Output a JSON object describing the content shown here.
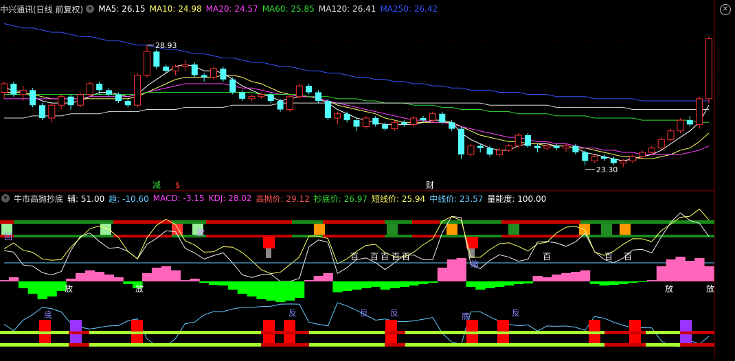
{
  "header": {
    "title": "中兴通讯(日线 前复权)",
    "indicators": [
      {
        "label": "MA5: 26.15",
        "color": "#ffffff"
      },
      {
        "label": "MA10: 24.98",
        "color": "#ffff66"
      },
      {
        "label": "MA20: 24.57",
        "color": "#ff44ff"
      },
      {
        "label": "MA60: 25.85",
        "color": "#33dd33"
      },
      {
        "label": "MA120: 26.41",
        "color": "#dddddd"
      },
      {
        "label": "MA250: 26.42",
        "color": "#3355ff"
      }
    ]
  },
  "subheader": {
    "title": "牛市高抛抄底",
    "indicators": [
      {
        "label": "辅: 51.00",
        "color": "#ffffff"
      },
      {
        "label": "趋: -10.60",
        "color": "#66ccff"
      },
      {
        "label": "MACD: -3.15",
        "color": "#ff44ff"
      },
      {
        "label": "KDJ: 28.02",
        "color": "#ff44ff"
      },
      {
        "label": "高抛价: 29.12",
        "color": "#ff5555"
      },
      {
        "label": "抄底价: 26.97",
        "color": "#33dd33"
      },
      {
        "label": "短线价: 25.94",
        "color": "#ffff66"
      },
      {
        "label": "中线价: 23.57",
        "color": "#66ccff"
      },
      {
        "label": "量能度: 100.00",
        "color": "#ffffff"
      }
    ]
  },
  "chart_data": {
    "type": "candlestick",
    "price_range": [
      22.3,
      30.3
    ],
    "annotations": {
      "high": "28.93",
      "low": "23.30"
    },
    "top_markers": [
      {
        "text": "减",
        "color": "#33dd33"
      },
      {
        "text": "$",
        "color": "#ff3333"
      },
      {
        "text": "财",
        "color": "#ffffff"
      }
    ],
    "candles": [
      [
        26.7,
        27.2,
        26.4,
        27.1
      ],
      [
        27.1,
        27.2,
        26.5,
        26.6
      ],
      [
        26.6,
        27.0,
        26.3,
        26.8
      ],
      [
        26.8,
        26.9,
        26.0,
        26.1
      ],
      [
        26.1,
        26.2,
        25.4,
        25.5
      ],
      [
        25.5,
        26.2,
        25.3,
        26.1
      ],
      [
        26.1,
        26.6,
        25.9,
        26.5
      ],
      [
        26.5,
        26.6,
        25.9,
        26.1
      ],
      [
        26.1,
        26.7,
        26.0,
        26.6
      ],
      [
        26.6,
        27.2,
        26.5,
        27.1
      ],
      [
        27.1,
        27.2,
        26.6,
        26.8
      ],
      [
        26.8,
        26.9,
        26.5,
        26.6
      ],
      [
        26.6,
        26.7,
        26.2,
        26.3
      ],
      [
        26.3,
        26.4,
        26.0,
        26.1
      ],
      [
        26.1,
        27.6,
        26.0,
        27.5
      ],
      [
        27.5,
        28.9,
        27.4,
        28.6
      ],
      [
        28.6,
        28.7,
        27.8,
        27.9
      ],
      [
        27.9,
        28.0,
        27.6,
        27.7
      ],
      [
        27.7,
        28.0,
        27.5,
        27.9
      ],
      [
        27.9,
        28.2,
        27.7,
        28.0
      ],
      [
        28.0,
        28.1,
        27.4,
        27.5
      ],
      [
        27.5,
        27.6,
        27.2,
        27.4
      ],
      [
        27.4,
        27.9,
        27.3,
        27.8
      ],
      [
        27.8,
        27.9,
        27.2,
        27.3
      ],
      [
        27.3,
        27.4,
        26.6,
        26.7
      ],
      [
        26.7,
        26.8,
        26.3,
        26.4
      ],
      [
        26.4,
        26.6,
        26.3,
        26.5
      ],
      [
        26.5,
        26.7,
        26.4,
        26.6
      ],
      [
        26.6,
        26.7,
        26.2,
        26.3
      ],
      [
        26.3,
        26.4,
        25.8,
        25.9
      ],
      [
        25.9,
        26.6,
        25.8,
        26.5
      ],
      [
        26.5,
        27.1,
        26.4,
        27.0
      ],
      [
        27.0,
        27.1,
        26.6,
        26.7
      ],
      [
        26.7,
        26.8,
        26.2,
        26.3
      ],
      [
        26.3,
        26.4,
        25.4,
        25.5
      ],
      [
        25.5,
        25.8,
        25.2,
        25.7
      ],
      [
        25.7,
        25.8,
        25.3,
        25.4
      ],
      [
        25.4,
        25.5,
        24.9,
        25.1
      ],
      [
        25.1,
        25.6,
        25.0,
        25.5
      ],
      [
        25.5,
        25.6,
        25.1,
        25.2
      ],
      [
        25.2,
        25.3,
        24.9,
        25.0
      ],
      [
        25.0,
        25.4,
        24.9,
        25.3
      ],
      [
        25.3,
        25.4,
        25.1,
        25.2
      ],
      [
        25.2,
        25.6,
        25.1,
        25.5
      ],
      [
        25.5,
        25.6,
        25.3,
        25.4
      ],
      [
        25.4,
        25.8,
        25.3,
        25.7
      ],
      [
        25.7,
        25.8,
        25.2,
        25.3
      ],
      [
        25.3,
        25.4,
        24.9,
        25.0
      ],
      [
        25.0,
        25.1,
        23.6,
        23.8
      ],
      [
        23.8,
        24.3,
        23.7,
        24.2
      ],
      [
        24.2,
        24.3,
        23.9,
        24.1
      ],
      [
        24.1,
        24.2,
        23.7,
        23.8
      ],
      [
        23.8,
        24.1,
        23.7,
        24.0
      ],
      [
        24.0,
        24.3,
        23.9,
        24.2
      ],
      [
        24.2,
        24.8,
        24.1,
        24.7
      ],
      [
        24.7,
        24.8,
        24.1,
        24.2
      ],
      [
        24.2,
        24.3,
        23.9,
        24.1
      ],
      [
        24.1,
        24.3,
        24.0,
        24.2
      ],
      [
        24.2,
        24.3,
        24.0,
        24.1
      ],
      [
        24.1,
        24.3,
        23.9,
        24.2
      ],
      [
        24.2,
        24.3,
        23.8,
        23.9
      ],
      [
        23.9,
        24.0,
        23.3,
        23.5
      ],
      [
        23.5,
        23.8,
        23.4,
        23.7
      ],
      [
        23.7,
        23.8,
        23.5,
        23.6
      ],
      [
        23.6,
        23.7,
        23.3,
        23.4
      ],
      [
        23.4,
        23.6,
        23.2,
        23.5
      ],
      [
        23.5,
        23.8,
        23.4,
        23.7
      ],
      [
        23.7,
        24.0,
        23.6,
        23.9
      ],
      [
        23.9,
        24.2,
        23.8,
        24.1
      ],
      [
        24.1,
        24.6,
        24.0,
        24.5
      ],
      [
        24.5,
        25.0,
        24.4,
        24.9
      ],
      [
        24.9,
        25.5,
        24.8,
        25.4
      ],
      [
        25.4,
        25.6,
        25.1,
        25.2
      ],
      [
        25.2,
        26.5,
        25.0,
        26.4
      ],
      [
        26.4,
        29.3,
        26.2,
        29.2
      ]
    ],
    "ma_lines": [
      {
        "name": "MA5",
        "color": "#ffffff",
        "values": [
          26.9,
          26.8,
          26.7,
          26.5,
          26.3,
          26.2,
          26.2,
          26.2,
          26.3,
          26.5,
          26.7,
          26.7,
          26.6,
          26.5,
          26.6,
          27.0,
          27.3,
          27.6,
          27.9,
          28.0,
          27.9,
          27.7,
          27.7,
          27.6,
          27.3,
          27.0,
          26.8,
          26.6,
          26.5,
          26.3,
          26.4,
          26.5,
          26.5,
          26.4,
          26.2,
          25.9,
          25.7,
          25.5,
          25.4,
          25.3,
          25.2,
          25.2,
          25.2,
          25.2,
          25.3,
          25.4,
          25.4,
          25.3,
          24.8,
          24.5,
          24.3,
          24.1,
          24.0,
          24.0,
          24.2,
          24.3,
          24.3,
          24.3,
          24.2,
          24.2,
          24.1,
          23.9,
          23.8,
          23.7,
          23.6,
          23.5,
          23.6,
          23.7,
          23.8,
          24.0,
          24.3,
          24.6,
          24.9,
          25.3,
          26.1
        ]
      },
      {
        "name": "MA10",
        "color": "#ffff66",
        "values": [
          26.7,
          26.7,
          26.7,
          26.6,
          26.5,
          26.4,
          26.4,
          26.4,
          26.4,
          26.4,
          26.4,
          26.4,
          26.4,
          26.4,
          26.5,
          26.7,
          26.9,
          27.1,
          27.3,
          27.4,
          27.4,
          27.4,
          27.4,
          27.5,
          27.5,
          27.4,
          27.2,
          27.1,
          26.9,
          26.7,
          26.6,
          26.5,
          26.5,
          26.4,
          26.3,
          26.1,
          26.0,
          25.9,
          25.8,
          25.7,
          25.5,
          25.4,
          25.3,
          25.3,
          25.3,
          25.3,
          25.3,
          25.3,
          25.1,
          24.9,
          24.7,
          24.6,
          24.5,
          24.4,
          24.4,
          24.3,
          24.3,
          24.2,
          24.2,
          24.2,
          24.1,
          24.1,
          24.0,
          23.9,
          23.8,
          23.7,
          23.7,
          23.6,
          23.6,
          23.7,
          23.8,
          24.0,
          24.1,
          24.4,
          24.8
        ]
      },
      {
        "name": "MA20",
        "color": "#ff44ff",
        "values": [
          26.4,
          26.4,
          26.4,
          26.4,
          26.4,
          26.4,
          26.4,
          26.4,
          26.4,
          26.5,
          26.5,
          26.5,
          26.5,
          26.5,
          26.6,
          26.7,
          26.8,
          26.9,
          27.0,
          27.1,
          27.1,
          27.1,
          27.1,
          27.1,
          27.0,
          26.9,
          26.9,
          26.8,
          26.7,
          26.6,
          26.6,
          26.5,
          26.5,
          26.4,
          26.3,
          26.2,
          26.1,
          26.0,
          25.9,
          25.8,
          25.7,
          25.6,
          25.5,
          25.4,
          25.4,
          25.3,
          25.3,
          25.2,
          25.1,
          25.0,
          24.9,
          24.8,
          24.7,
          24.6,
          24.6,
          24.5,
          24.4,
          24.4,
          24.3,
          24.3,
          24.2,
          24.1,
          24.1,
          24.0,
          24.0,
          23.9,
          23.9,
          23.8,
          23.8,
          23.8,
          23.8,
          23.8,
          23.9,
          24.0,
          24.2
        ]
      },
      {
        "name": "MA60",
        "color": "#33dd33",
        "values": [
          26.6,
          26.6,
          26.6,
          26.6,
          26.6,
          26.6,
          26.6,
          26.6,
          26.6,
          26.6,
          26.6,
          26.6,
          26.6,
          26.6,
          26.6,
          26.7,
          26.7,
          26.7,
          26.7,
          26.7,
          26.7,
          26.7,
          26.7,
          26.7,
          26.7,
          26.7,
          26.7,
          26.6,
          26.6,
          26.6,
          26.6,
          26.6,
          26.5,
          26.5,
          26.5,
          26.4,
          26.4,
          26.4,
          26.3,
          26.3,
          26.2,
          26.2,
          26.2,
          26.1,
          26.1,
          26.1,
          26.0,
          26.0,
          25.9,
          25.9,
          25.9,
          25.8,
          25.8,
          25.8,
          25.7,
          25.7,
          25.7,
          25.7,
          25.6,
          25.6,
          25.6,
          25.6,
          25.5,
          25.5,
          25.5,
          25.5,
          25.5,
          25.4,
          25.4,
          25.4,
          25.4,
          25.4,
          25.4,
          25.3,
          25.3
        ]
      },
      {
        "name": "MA120",
        "color": "#dddddd",
        "values": [
          25.5,
          25.5,
          25.5,
          25.6,
          25.6,
          25.6,
          25.6,
          25.7,
          25.7,
          25.7,
          25.7,
          25.8,
          25.8,
          25.8,
          25.8,
          25.9,
          25.9,
          25.9,
          25.9,
          26.0,
          26.0,
          26.0,
          26.0,
          26.0,
          26.1,
          26.1,
          26.1,
          26.1,
          26.1,
          26.2,
          26.2,
          26.2,
          26.2,
          26.2,
          26.2,
          26.2,
          26.2,
          26.2,
          26.2,
          26.2,
          26.2,
          26.2,
          26.2,
          26.2,
          26.2,
          26.2,
          26.2,
          26.2,
          26.2,
          26.2,
          26.2,
          26.1,
          26.1,
          26.1,
          26.1,
          26.1,
          26.1,
          26.1,
          26.0,
          26.0,
          26.0,
          26.0,
          26.0,
          26.0,
          26.0,
          26.0,
          25.9,
          25.9,
          25.9,
          25.9,
          25.9,
          25.9,
          25.9,
          25.9,
          25.9
        ]
      },
      {
        "name": "MA250",
        "color": "#3355ff",
        "values": [
          29.9,
          29.8,
          29.7,
          29.7,
          29.6,
          29.5,
          29.5,
          29.4,
          29.3,
          29.3,
          29.2,
          29.1,
          29.1,
          29.0,
          28.9,
          28.9,
          28.8,
          28.7,
          28.7,
          28.6,
          28.5,
          28.5,
          28.4,
          28.3,
          28.3,
          28.2,
          28.1,
          28.1,
          28.0,
          27.9,
          27.9,
          27.8,
          27.7,
          27.7,
          27.6,
          27.6,
          27.5,
          27.4,
          27.4,
          27.3,
          27.3,
          27.2,
          27.2,
          27.1,
          27.1,
          27.0,
          27.0,
          26.9,
          26.9,
          26.8,
          26.8,
          26.8,
          26.7,
          26.7,
          26.7,
          26.6,
          26.6,
          26.6,
          26.5,
          26.5,
          26.5,
          26.5,
          26.4,
          26.4,
          26.4,
          26.4,
          26.4,
          26.3,
          26.3,
          26.3,
          26.3,
          26.3,
          26.3,
          26.3,
          26.3
        ]
      }
    ],
    "signal_labels": [
      {
        "text": "回",
        "color": "#8888ff"
      },
      {
        "text": "放",
        "color": "#cc99ff"
      },
      {
        "text": "百",
        "color": "#ffffff"
      },
      {
        "text": "百",
        "color": "#ffffff"
      },
      {
        "text": "百",
        "color": "#ffffff"
      },
      {
        "text": "百",
        "color": "#ffffff"
      },
      {
        "text": "百",
        "color": "#ffffff"
      },
      {
        "text": "缩",
        "color": "#8888ff"
      },
      {
        "text": "百",
        "color": "#ffffff"
      },
      {
        "text": "百",
        "color": "#ffffff"
      },
      {
        "text": "百",
        "color": "#ffffff"
      },
      {
        "text": "放",
        "color": "#ffffff"
      },
      {
        "text": "放",
        "color": "#ffffff"
      },
      {
        "text": "放",
        "color": "#ffffff"
      },
      {
        "text": "放",
        "color": "#ffffff"
      },
      {
        "text": "底",
        "color": "#8888ff"
      },
      {
        "text": "反",
        "color": "#8888ff"
      },
      {
        "text": "反",
        "color": "#8888ff"
      },
      {
        "text": "反",
        "color": "#8888ff"
      },
      {
        "text": "底",
        "color": "#8888ff"
      },
      {
        "text": "反",
        "color": "#8888ff"
      }
    ],
    "bars": [
      0.2,
      0.6,
      -1.0,
      -1.8,
      -2.6,
      -2.2,
      -1.4,
      0.4,
      1.2,
      1.6,
      1.4,
      1.0,
      0.6,
      -0.4,
      -1.0,
      1.2,
      2.0,
      2.2,
      1.6,
      0.2,
      0.4,
      -0.2,
      -0.5,
      -0.6,
      -1.2,
      -1.8,
      -2.2,
      -2.6,
      -2.8,
      -3.0,
      -2.8,
      -2.4,
      0.2,
      0.8,
      1.2,
      -1.6,
      -1.4,
      -1.2,
      -1.0,
      -0.8,
      -1.2,
      -1.0,
      -0.8,
      -0.6,
      -0.4,
      -0.2,
      2.0,
      3.2,
      3.4,
      -0.8,
      -1.2,
      -1.0,
      -0.8,
      -0.6,
      -0.4,
      -0.3,
      0.8,
      0.6,
      1.0,
      1.2,
      1.4,
      1.6,
      -0.4,
      -0.6,
      -0.5,
      -0.4,
      -0.2,
      -0.1,
      0.2,
      2.2,
      3.2,
      3.6,
      3.0,
      3.4,
      2.2
    ]
  }
}
